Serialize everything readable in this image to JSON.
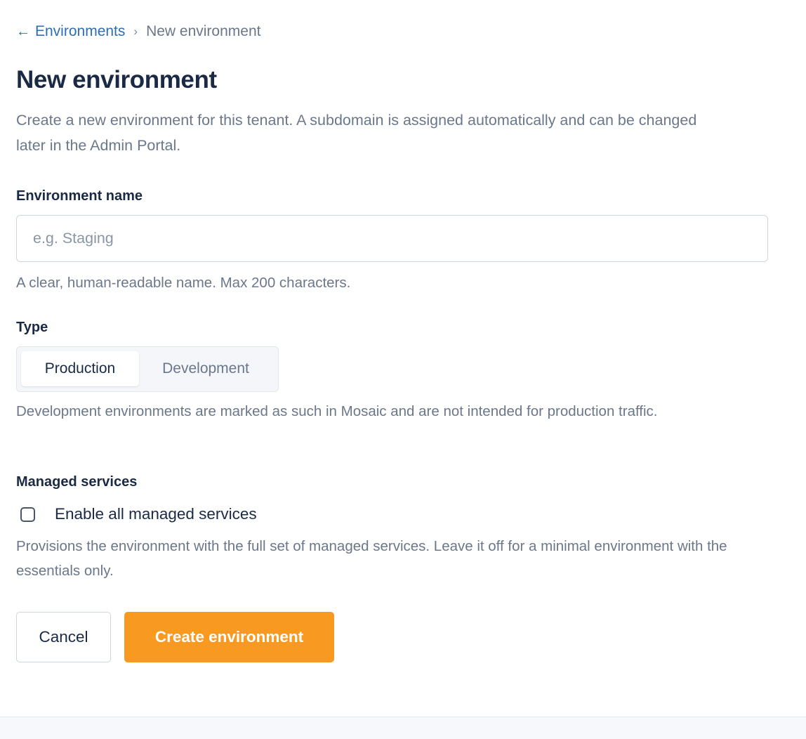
{
  "breadcrumb": {
    "back_icon": "arrow-left-icon",
    "back_icon_glyph": "←",
    "parent_label": "Environments",
    "separator_glyph": "›",
    "current_label": "New environment"
  },
  "header": {
    "title": "New environment",
    "description": "Create a new environment for this tenant. A subdomain is assigned automatically and can be changed later in the Admin Portal."
  },
  "form": {
    "name": {
      "label": "Environment name",
      "value": "",
      "placeholder": "e.g. Staging",
      "hint": "A clear, human-readable name. Max 200 characters."
    },
    "type": {
      "label": "Type",
      "options": [
        "Production",
        "Development"
      ],
      "selected": "Production",
      "hint": "Development environments are marked as such in Mosaic and are not intended for production traffic."
    },
    "managed_services": {
      "label": "Managed services",
      "checkbox_label": "Enable all managed services",
      "checked": false,
      "hint": "Provisions the environment with the full set of managed services. Leave it off for a minimal environment with the essentials only."
    }
  },
  "actions": {
    "cancel_label": "Cancel",
    "submit_label": "Create environment"
  },
  "colors": {
    "link": "#2f6db5",
    "primary_button": "#f89a22",
    "heading": "#1b2a44",
    "muted_text": "#6b778a"
  }
}
